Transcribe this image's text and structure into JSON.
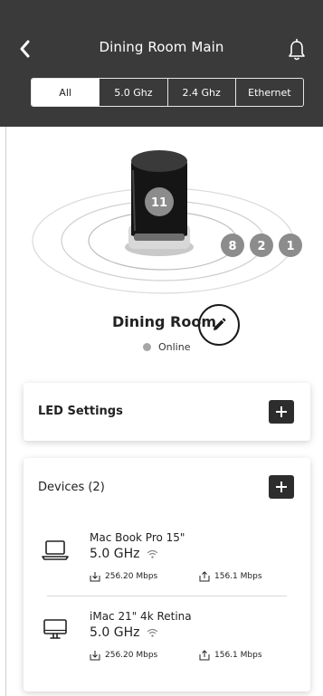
{
  "header": {
    "title": "Dining Room Main",
    "tabs": [
      {
        "label": "All",
        "selected": true
      },
      {
        "label": "5.0 Ghz",
        "selected": false
      },
      {
        "label": "2.4 Ghz",
        "selected": false
      },
      {
        "label": "Ethernet",
        "selected": false
      }
    ]
  },
  "node": {
    "count_badge": "11",
    "ring_badges": [
      "8",
      "2",
      "1"
    ],
    "name": "Dining Room",
    "status": "Online"
  },
  "led": {
    "title": "LED Settings"
  },
  "devices": {
    "title": "Devices (2)",
    "items": [
      {
        "name": "Mac Book Pro 15\"",
        "band": "5.0 GHz",
        "download": "256.20 Mbps",
        "upload": "156.1 Mbps",
        "icon": "laptop-icon"
      },
      {
        "name": "iMac 21\" 4k Retina",
        "band": "5.0 GHz",
        "download": "256.20 Mbps",
        "upload": "156.1 Mbps",
        "icon": "desktop-icon"
      }
    ]
  },
  "colors": {
    "header_bg": "#3a3a3a",
    "badge": "#8c8c8c",
    "status_dot": "#a6a6a6",
    "button": "#2d2d2d"
  }
}
